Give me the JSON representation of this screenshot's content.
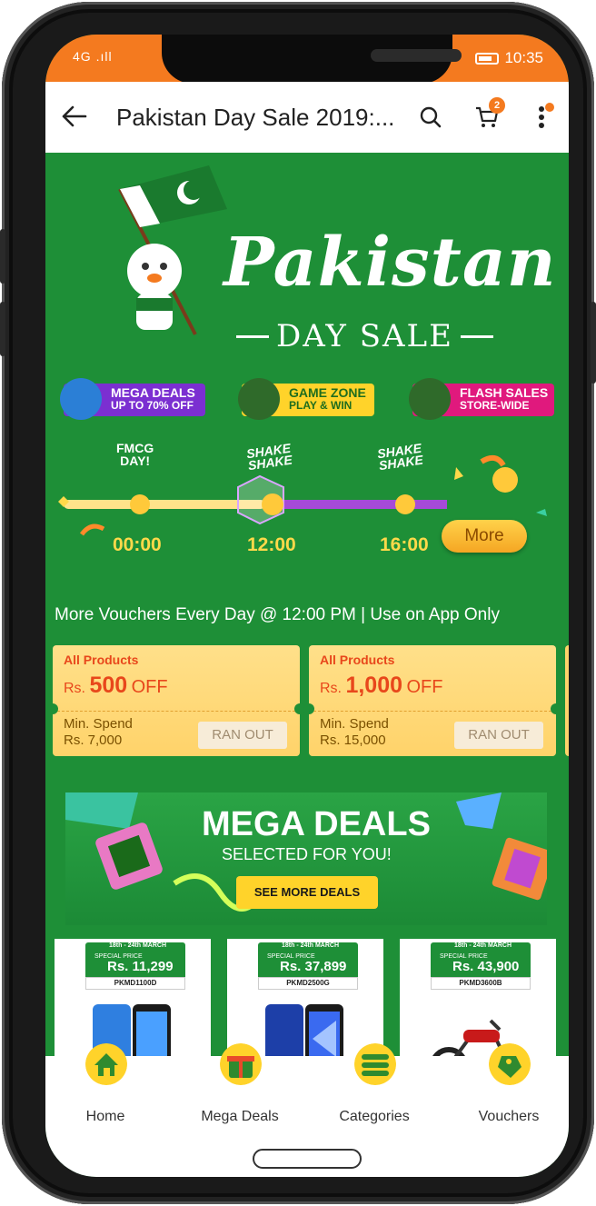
{
  "status_bar": {
    "signal": "4G .ıll",
    "time": "10:35"
  },
  "header": {
    "title": "Pakistan Day Sale 2019:...",
    "cart_count": "2"
  },
  "hero": {
    "title": "Pakistan",
    "subtitle": "DAY SALE"
  },
  "pills": [
    {
      "line1": "MEGA DEALS",
      "line2": "UP TO 70% OFF",
      "bg": "#7b2fd1"
    },
    {
      "line1": "GAME ZONE",
      "line2": "PLAY & WIN",
      "bg": "#ffd32a"
    },
    {
      "line1": "FLASH SALES",
      "line2": "STORE-WIDE",
      "bg": "#e0197d"
    }
  ],
  "timeline": {
    "fmcg_label": "FMCG\nDAY!",
    "shake1": "SHAKE\nSHAKE",
    "shake2": "SHAKE\nSHAKE",
    "times": [
      "00:00",
      "12:00",
      "16:00"
    ],
    "more_label": "More"
  },
  "voucher_line": "More Vouchers Every Day @ 12:00 PM | Use on App Only",
  "vouchers": [
    {
      "category": "All Products",
      "currency": "Rs.",
      "amount": "500",
      "off": "OFF",
      "min_label": "Min. Spend",
      "min_value": "Rs. 7,000",
      "status": "RAN OUT"
    },
    {
      "category": "All Products",
      "currency": "Rs.",
      "amount": "1,000",
      "off": "OFF",
      "min_label": "Min. Spend",
      "min_value": "Rs. 15,000",
      "status": "RAN OUT"
    }
  ],
  "mega_banner": {
    "heading": "MEGA DEALS",
    "sub": "SELECTED FOR YOU!",
    "button": "SEE MORE DEALS"
  },
  "products": [
    {
      "date": "18th - 24th MARCH",
      "special": "SPECIAL PRICE",
      "price": "Rs. 11,299",
      "code": "PKMD1100D"
    },
    {
      "date": "18th - 24th MARCH",
      "special": "SPECIAL PRICE",
      "price": "Rs. 37,899",
      "code": "PKMD2500G"
    },
    {
      "date": "18th - 24th MARCH",
      "special": "SPECIAL PRICE",
      "price": "Rs. 43,900",
      "code": "PKMD3600B"
    }
  ],
  "bottom_nav": [
    {
      "label": "Home"
    },
    {
      "label": "Mega Deals"
    },
    {
      "label": "Categories"
    },
    {
      "label": "Vouchers"
    }
  ],
  "colors": {
    "brand_orange": "#f47a1f",
    "sale_green": "#1e8f37",
    "accent_yellow": "#ffd94a"
  }
}
